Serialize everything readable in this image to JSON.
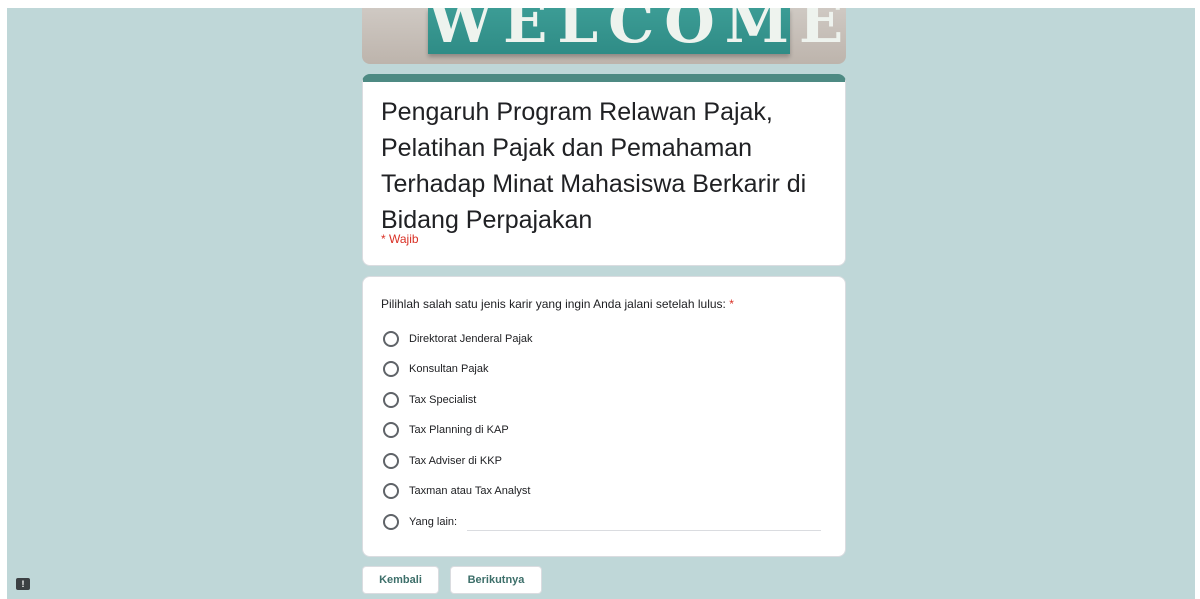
{
  "banner": {
    "text": "WELCOME"
  },
  "form": {
    "title": "Pengaruh Program Relawan Pajak, Pelatihan Pajak dan Pemahaman Terhadap Minat Mahasiswa Berkarir di Bidang Perpajakan",
    "required_note": "* Wajib"
  },
  "question": {
    "text": "Pilihlah salah satu jenis karir yang ingin Anda jalani setelah lulus:",
    "required_mark": "*",
    "options": [
      "Direktorat Jenderal Pajak",
      "Konsultan Pajak",
      "Tax Specialist",
      "Tax Planning di KAP",
      "Tax Adviser di KKP",
      "Taxman atau Tax Analyst",
      "Yang lain:"
    ]
  },
  "navigation": {
    "back_label": "Kembali",
    "next_label": "Berikutnya"
  },
  "icons": {
    "report": "report-problem-icon"
  },
  "colors": {
    "background": "#bfd7d8",
    "accent": "#4d8a83",
    "required": "#d93025"
  }
}
